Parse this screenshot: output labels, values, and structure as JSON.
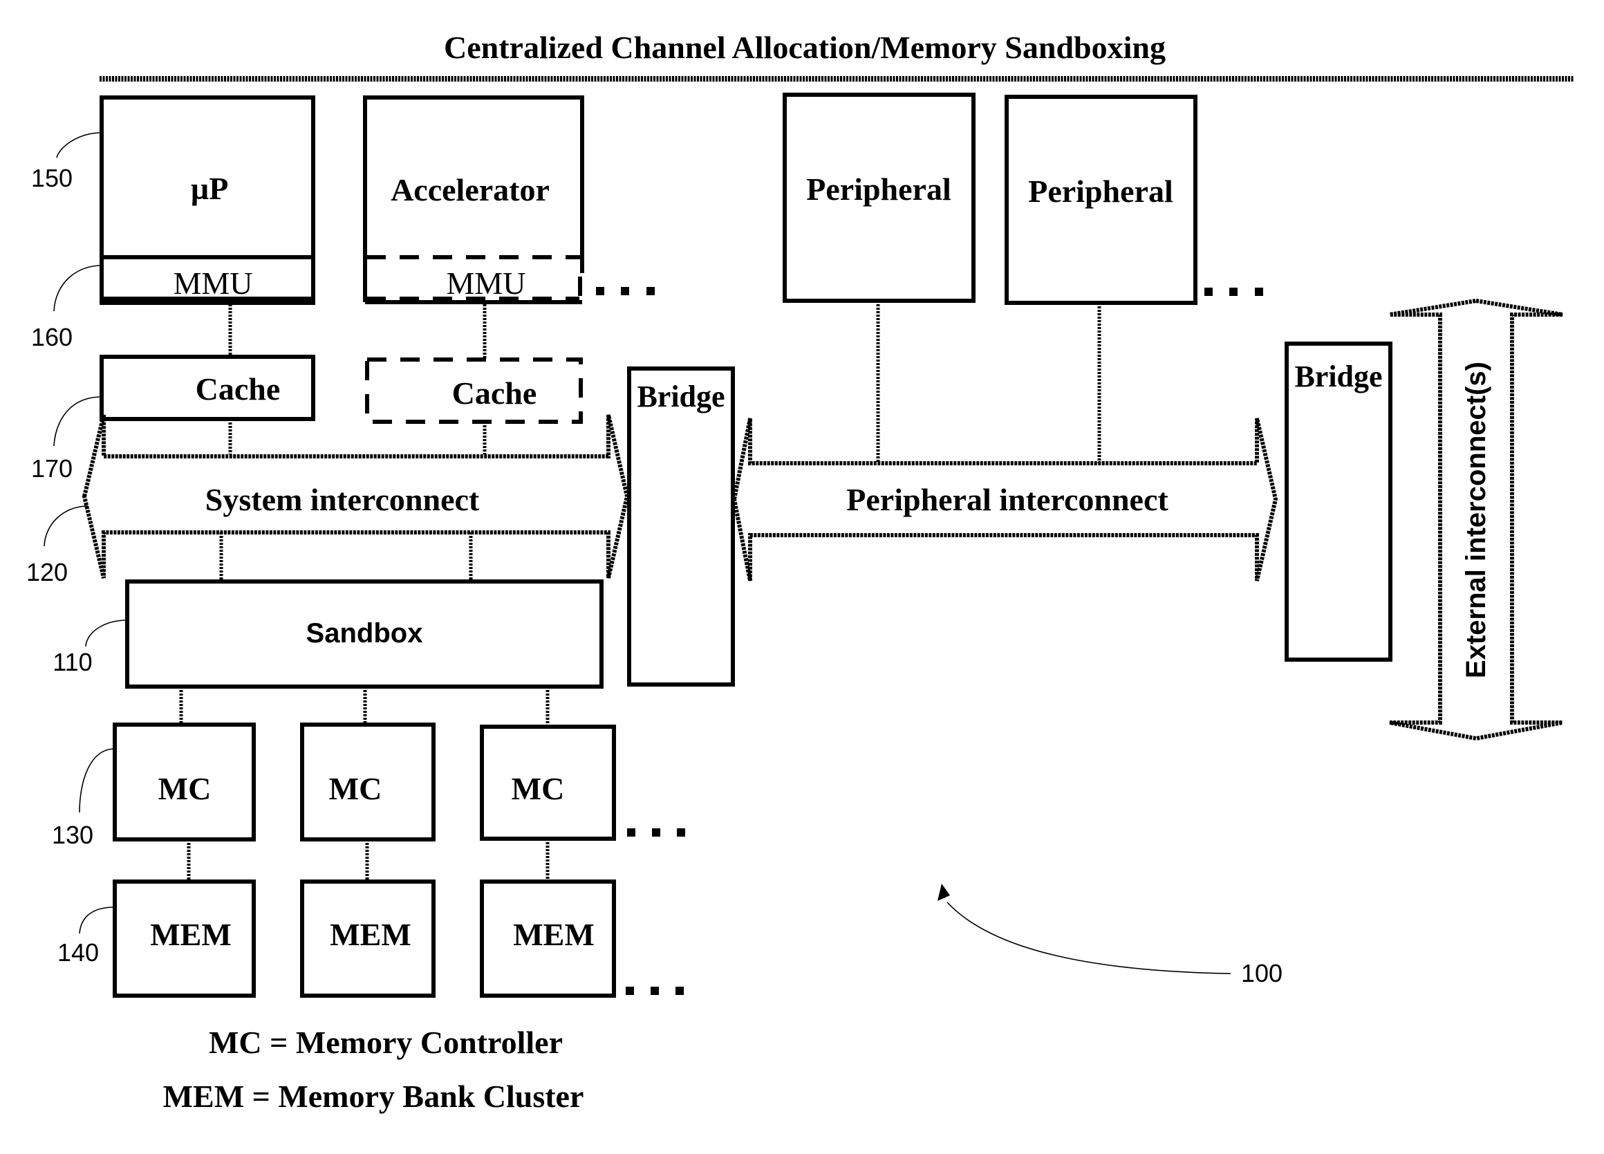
{
  "title": "Centralized Channel Allocation/Memory Sandboxing",
  "blocks": {
    "microprocessor": "µP",
    "mmu_1": "MMU",
    "accelerator": "Accelerator",
    "mmu_2": "MMU",
    "cache_1": "Cache",
    "cache_2": "Cache",
    "bridge_1": "Bridge",
    "peripheral_1": "Peripheral",
    "peripheral_2": "Peripheral",
    "bridge_2": "Bridge",
    "sandbox": "Sandbox",
    "mc": [
      "MC",
      "MC",
      "MC"
    ],
    "mem": [
      "MEM",
      "MEM",
      "MEM"
    ]
  },
  "interconnects": {
    "system": "System interconnect",
    "peripheral": "Peripheral interconnect",
    "external": "External interconnect(s)"
  },
  "reference_numerals": {
    "microprocessor": "150",
    "mmu": "160",
    "cache": "170",
    "system_interconnect": "120",
    "sandbox": "110",
    "memory_controller": "130",
    "memory": "140",
    "system": "100"
  },
  "legend": [
    "MC = Memory Controller",
    "MEM = Memory Bank Cluster"
  ],
  "ellipsis": "..."
}
